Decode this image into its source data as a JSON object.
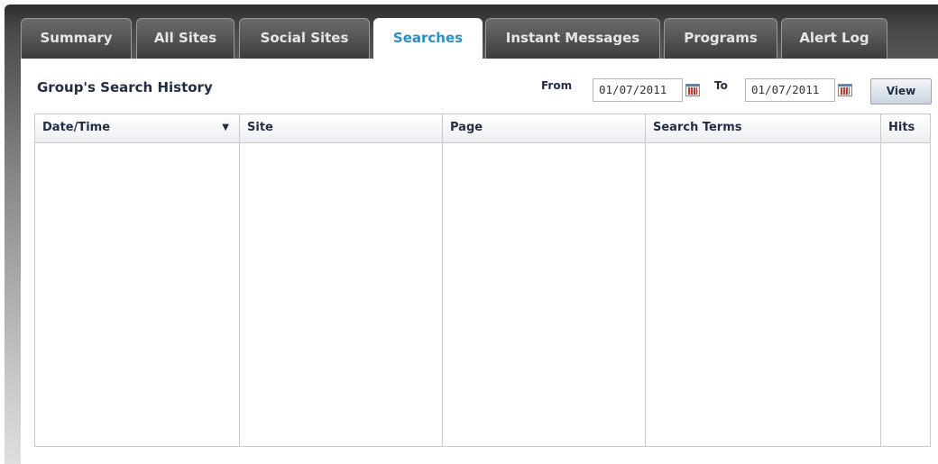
{
  "tabs": [
    {
      "label": "Summary",
      "active": false
    },
    {
      "label": "All Sites",
      "active": false
    },
    {
      "label": "Social Sites",
      "active": false
    },
    {
      "label": "Searches",
      "active": true
    },
    {
      "label": "Instant Messages",
      "active": false
    },
    {
      "label": "Programs",
      "active": false
    },
    {
      "label": "Alert Log",
      "active": false
    }
  ],
  "panel": {
    "title": "Group's Search History",
    "from_label": "From",
    "from_value": "01/07/2011",
    "to_label": "To",
    "to_value": "01/07/2011",
    "view_label": "View"
  },
  "table": {
    "columns": [
      "Date/Time",
      "Site",
      "Page",
      "Search Terms",
      "Hits"
    ],
    "sort_indicator": "▼",
    "rows": []
  },
  "colors": {
    "active_tab_text": "#2a8fd0",
    "heading_text": "#1f2d45"
  }
}
